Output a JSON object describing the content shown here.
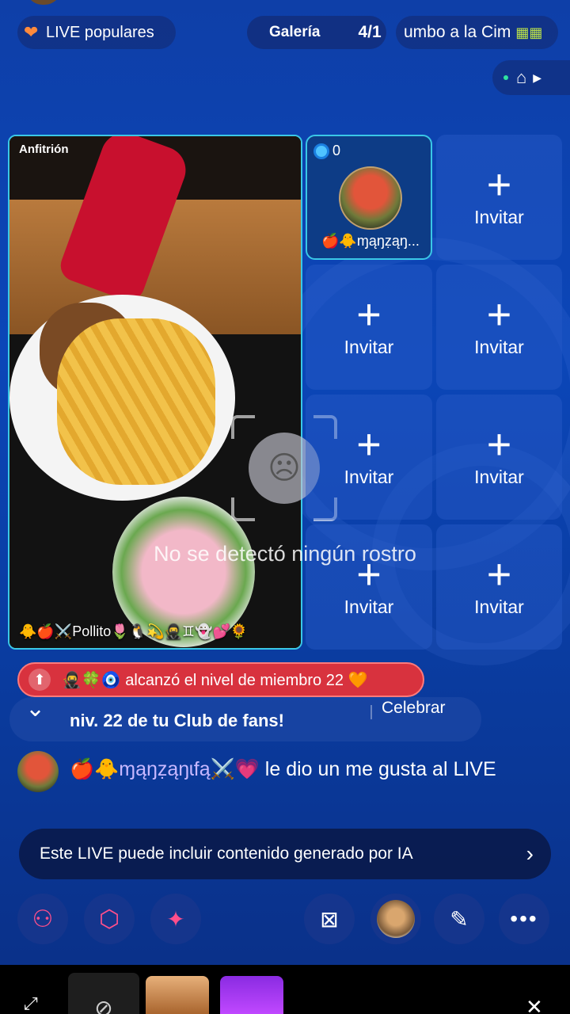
{
  "top": {
    "popular_label": "LIVE populares",
    "gallery_label": "Galería",
    "gallery_count": "4/1",
    "ticker_text": "umbo a la Cim"
  },
  "host": {
    "label": "Anfitrión",
    "name": "🐥🍎⚔️Pollito🌷🐧💫🥷♊👻💕🌻",
    "face_warning": "No se detectó ningún rostro"
  },
  "guest": {
    "score": "0",
    "name": "🍎🐥ɱąŋẓąŋ..."
  },
  "invite_label": "Invitar",
  "notifications": {
    "level_banner": "🥷🍀🧿 alcanzó el nivel de miembro 22 🧡",
    "fan_club_text": "niv. 22 de tu Club de fans!",
    "celebrate_label": "Celebrar"
  },
  "chat": {
    "name": "🍎🐥ɱąŋẓąŋɩfą⚔️💗",
    "text": " le dio un me gusta al LIVE"
  },
  "ai_notice": "Este LIVE puede incluir contenido generado por IA",
  "colors": {
    "accent_pink": "#ff4f8b",
    "banner_red": "#d8323e",
    "grid_blue": "#2a5ac8"
  }
}
